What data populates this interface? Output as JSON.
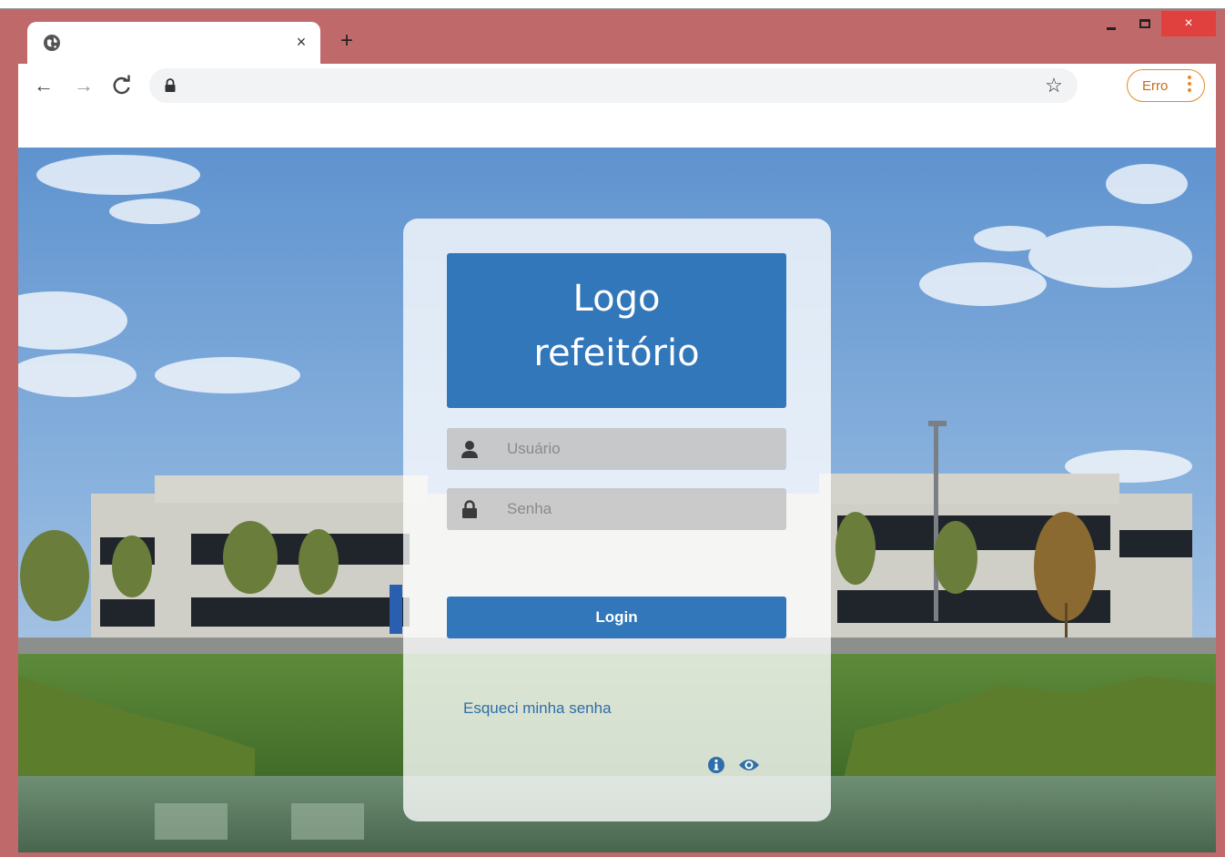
{
  "browser": {
    "tab": {
      "icon": "globe-icon",
      "close": "×"
    },
    "new_tab": "+",
    "window_controls": {
      "close": "×"
    },
    "toolbar": {
      "back": "←",
      "forward": "→",
      "reload": "C",
      "bookmark_star": "☆",
      "error_chip_label": "Erro"
    }
  },
  "login": {
    "logo_line1": "Logo",
    "logo_line2": "refeitório",
    "username_placeholder": "Usuário",
    "password_placeholder": "Senha",
    "login_button": "Login",
    "forgot_password": "Esqueci minha senha",
    "footer_icons": [
      "info-icon",
      "eye-icon"
    ]
  },
  "colors": {
    "window_frame": "#c0696a",
    "brand_blue": "#3277b9",
    "link_blue": "#2f6ea8",
    "error_orange": "#e38a2b",
    "close_red": "#e0403e"
  }
}
